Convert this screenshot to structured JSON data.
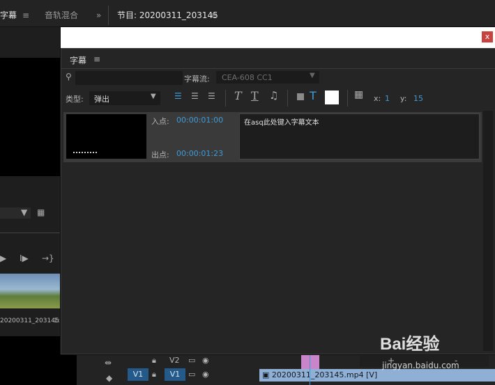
{
  "top_tabs": {
    "tab1": "字幕",
    "tab2": "音轨混合",
    "tab3": "节目: 20200311_203145",
    "menu_glyph": "≡",
    "more_glyph": "»"
  },
  "dialog": {
    "close_label": "x",
    "panel_title": "字幕",
    "panel_menu": "≡",
    "search_placeholder": "",
    "stream_label": "字幕流:",
    "stream_value": "CEA-608 CC1",
    "type_label": "类型:",
    "type_value": "弹出",
    "x_label": "x:",
    "x_value": "1",
    "y_label": "y:",
    "y_value": "15",
    "caption": {
      "in_label": "入点:",
      "in_time": "00:00:01:00",
      "out_label": "出点:",
      "out_time": "00:00:01:23",
      "text": "在asq此处键入字幕文本"
    },
    "add_label": "+",
    "remove_label": "-"
  },
  "left_panel": {
    "clip_name": "20200311_203145",
    "clip_suffix": "1:"
  },
  "timeline": {
    "v2_label": "V2",
    "v1_left": "V1",
    "v1_right": "V1",
    "clip_label": "20200311_203145.mp4 [V]"
  },
  "watermark": {
    "brand": "Bai经验",
    "url": "jingyan.baidu.com"
  },
  "colors": {
    "accent": "#3f9bd6",
    "close": "#c9433e",
    "clip": "#8fb0d4",
    "marker": "#c985c9"
  }
}
